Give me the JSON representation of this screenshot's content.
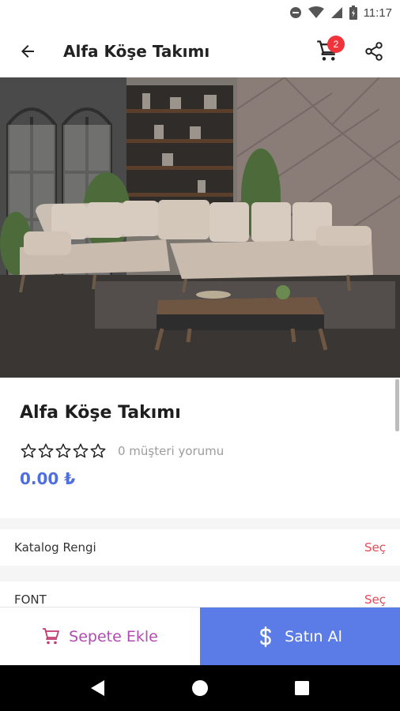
{
  "status_bar": {
    "time": "11:17"
  },
  "app_bar": {
    "title": "Alfa Köşe Takımı",
    "cart_badge": "2"
  },
  "product": {
    "title": "Alfa Köşe Takımı",
    "rating": 0,
    "review_text": "0 müşteri yorumu",
    "price": "0.00 ₺"
  },
  "options": [
    {
      "label": "Katalog Rengi",
      "action": "Seç"
    },
    {
      "label": "FONT",
      "action": "Seç"
    }
  ],
  "bottom_bar": {
    "add_to_cart": "Sepete Ekle",
    "buy_now": "Satın Al"
  },
  "colors": {
    "accent_blue": "#5b7ce6",
    "price_blue": "#4f6fe0",
    "badge_red": "#f2343a",
    "select_red": "#e84a57",
    "cart_purple": "#b24bb0"
  }
}
